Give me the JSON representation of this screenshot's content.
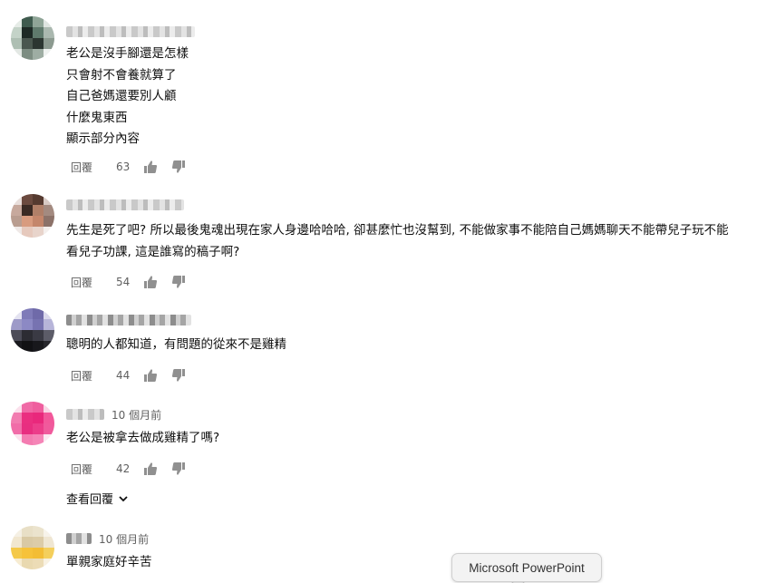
{
  "comments": [
    {
      "timestamp": "",
      "lines": [
        "老公是沒手腳還是怎樣",
        "只會射不會養就算了",
        "自己爸媽還要別人顧",
        "什麼鬼東西",
        "顯示部分內容"
      ],
      "reply_label": "回覆",
      "likes": "63"
    },
    {
      "timestamp": "",
      "lines": [
        "先生是死了吧? 所以最後鬼魂出現在家人身邊哈哈哈, 卻甚麼忙也沒幫到, 不能做家事不能陪自己媽媽聊天不能帶兒子玩不能",
        "看兒子功課, 這是誰寫的稿子啊?"
      ],
      "reply_label": "回覆",
      "likes": "54"
    },
    {
      "timestamp": "",
      "lines": [
        "聰明的人都知道，有問題的從來不是雞精"
      ],
      "reply_label": "回覆",
      "likes": "44"
    },
    {
      "timestamp": "10 個月前",
      "lines": [
        "老公是被拿去做成雞精了嗎?"
      ],
      "reply_label": "回覆",
      "likes": "42"
    },
    {
      "timestamp": "10 個月前",
      "lines": [
        "單親家庭好辛苦"
      ]
    }
  ],
  "view_replies_label": "查看回覆",
  "tooltip": "Microsoft PowerPoint",
  "icons": [
    "thumb-up-icon",
    "thumb-down-icon",
    "chevron-down-icon"
  ]
}
